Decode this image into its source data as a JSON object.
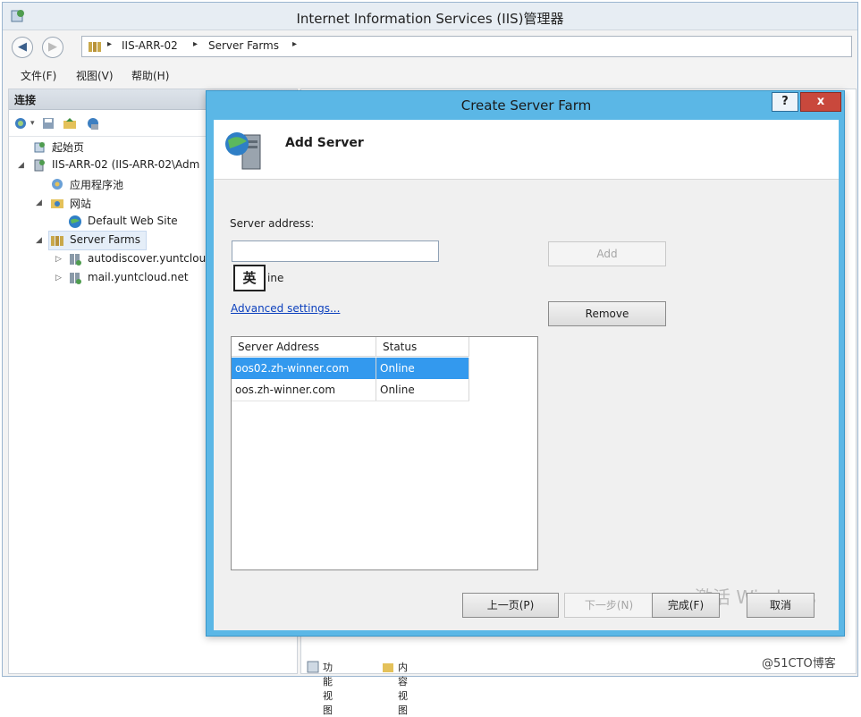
{
  "window": {
    "title": "Internet Information Services (IIS)管理器"
  },
  "address_bar": {
    "crumbs": [
      "IIS-ARR-02",
      "Server Farms"
    ],
    "separator": "▸"
  },
  "menu": [
    "文件(F)",
    "视图(V)",
    "帮助(H)"
  ],
  "connections": {
    "title": "连接",
    "tree": [
      {
        "label": "起始页"
      },
      {
        "label": "IIS-ARR-02 (IIS-ARR-02\\Adm"
      },
      {
        "label": "应用程序池"
      },
      {
        "label": "网站"
      },
      {
        "label": "Default Web Site"
      },
      {
        "label": "Server Farms"
      },
      {
        "label": "autodiscover.yuntclou"
      },
      {
        "label": "mail.yuntcloud.net"
      }
    ]
  },
  "bottom_tabs": [
    "功能视图",
    "内容视图"
  ],
  "watermark": "@51CTO博客",
  "dialog": {
    "title": "Create Server Farm",
    "help_label": "?",
    "close_label": "x",
    "header_title": "Add Server",
    "server_address_label": "Server address:",
    "server_address_value": "",
    "ime_indicator": "英",
    "online_label": "ine",
    "advanced_link": "Advanced settings...",
    "add_label": "Add",
    "remove_label": "Remove",
    "list": {
      "columns": [
        "Server Address",
        "Status"
      ],
      "rows": [
        {
          "address": "oos02.zh-winner.com",
          "status": "Online",
          "selected": true
        },
        {
          "address": "oos.zh-winner.com",
          "status": "Online",
          "selected": false
        }
      ]
    },
    "buttons": {
      "prev": "上一页(P)",
      "next": "下一步(N)",
      "finish": "完成(F)",
      "cancel": "取消"
    },
    "activate_text": "激活 Windows"
  }
}
